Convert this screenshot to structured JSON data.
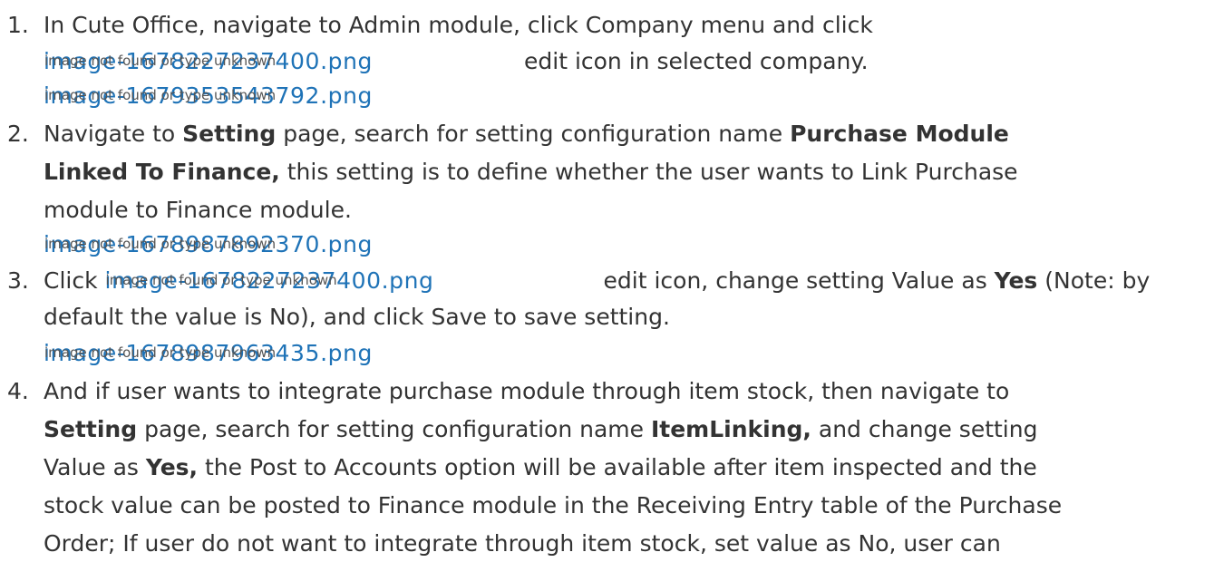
{
  "colors": {
    "text": "#333333",
    "link": "#1f73b7"
  },
  "broken_alt_text": "image not found or type unknown",
  "steps": [
    {
      "number": "1.",
      "line1": "In Cute Office, navigate to Admin module, click Company menu and click",
      "image1": "image-1678227237400.png",
      "line2_text": "edit icon in selected company.",
      "image2": "image-1679353543792.png"
    },
    {
      "number": "2.",
      "t1": "Navigate to ",
      "b1": "Setting",
      "t2": " page, search for setting configuration name ",
      "b2": "Purchase Module",
      "b3": "Linked To Finance,",
      "t3": " this setting is to define whether the user wants to Link Purchase",
      "t4": "module to Finance module.",
      "image": "image-1678987892370.png"
    },
    {
      "number": "3.",
      "t1": "Click ",
      "image1": "image-1678227237400.png",
      "t2": "edit icon, change setting Value as ",
      "b1": "Yes",
      "t3": " (Note: by",
      "t4": "default the value is No), and click Save to save setting.",
      "image2": "image-1678987963435.png"
    },
    {
      "number": "4.",
      "t1": "And if user wants to integrate purchase module through item stock, then navigate to",
      "b1": "Setting",
      "t2": " page, search for setting configuration name ",
      "b2": "ItemLinking,",
      "t3": " and change setting",
      "t4": "Value as ",
      "b3": "Yes,",
      "t5": " the Post to Accounts option will be available after item inspected and the",
      "t6": "stock value can be posted to Finance module  in the Receiving Entry table of the Purchase",
      "t7": "Order; If user do not want to integrate through item stock, set value as No, user can"
    }
  ]
}
